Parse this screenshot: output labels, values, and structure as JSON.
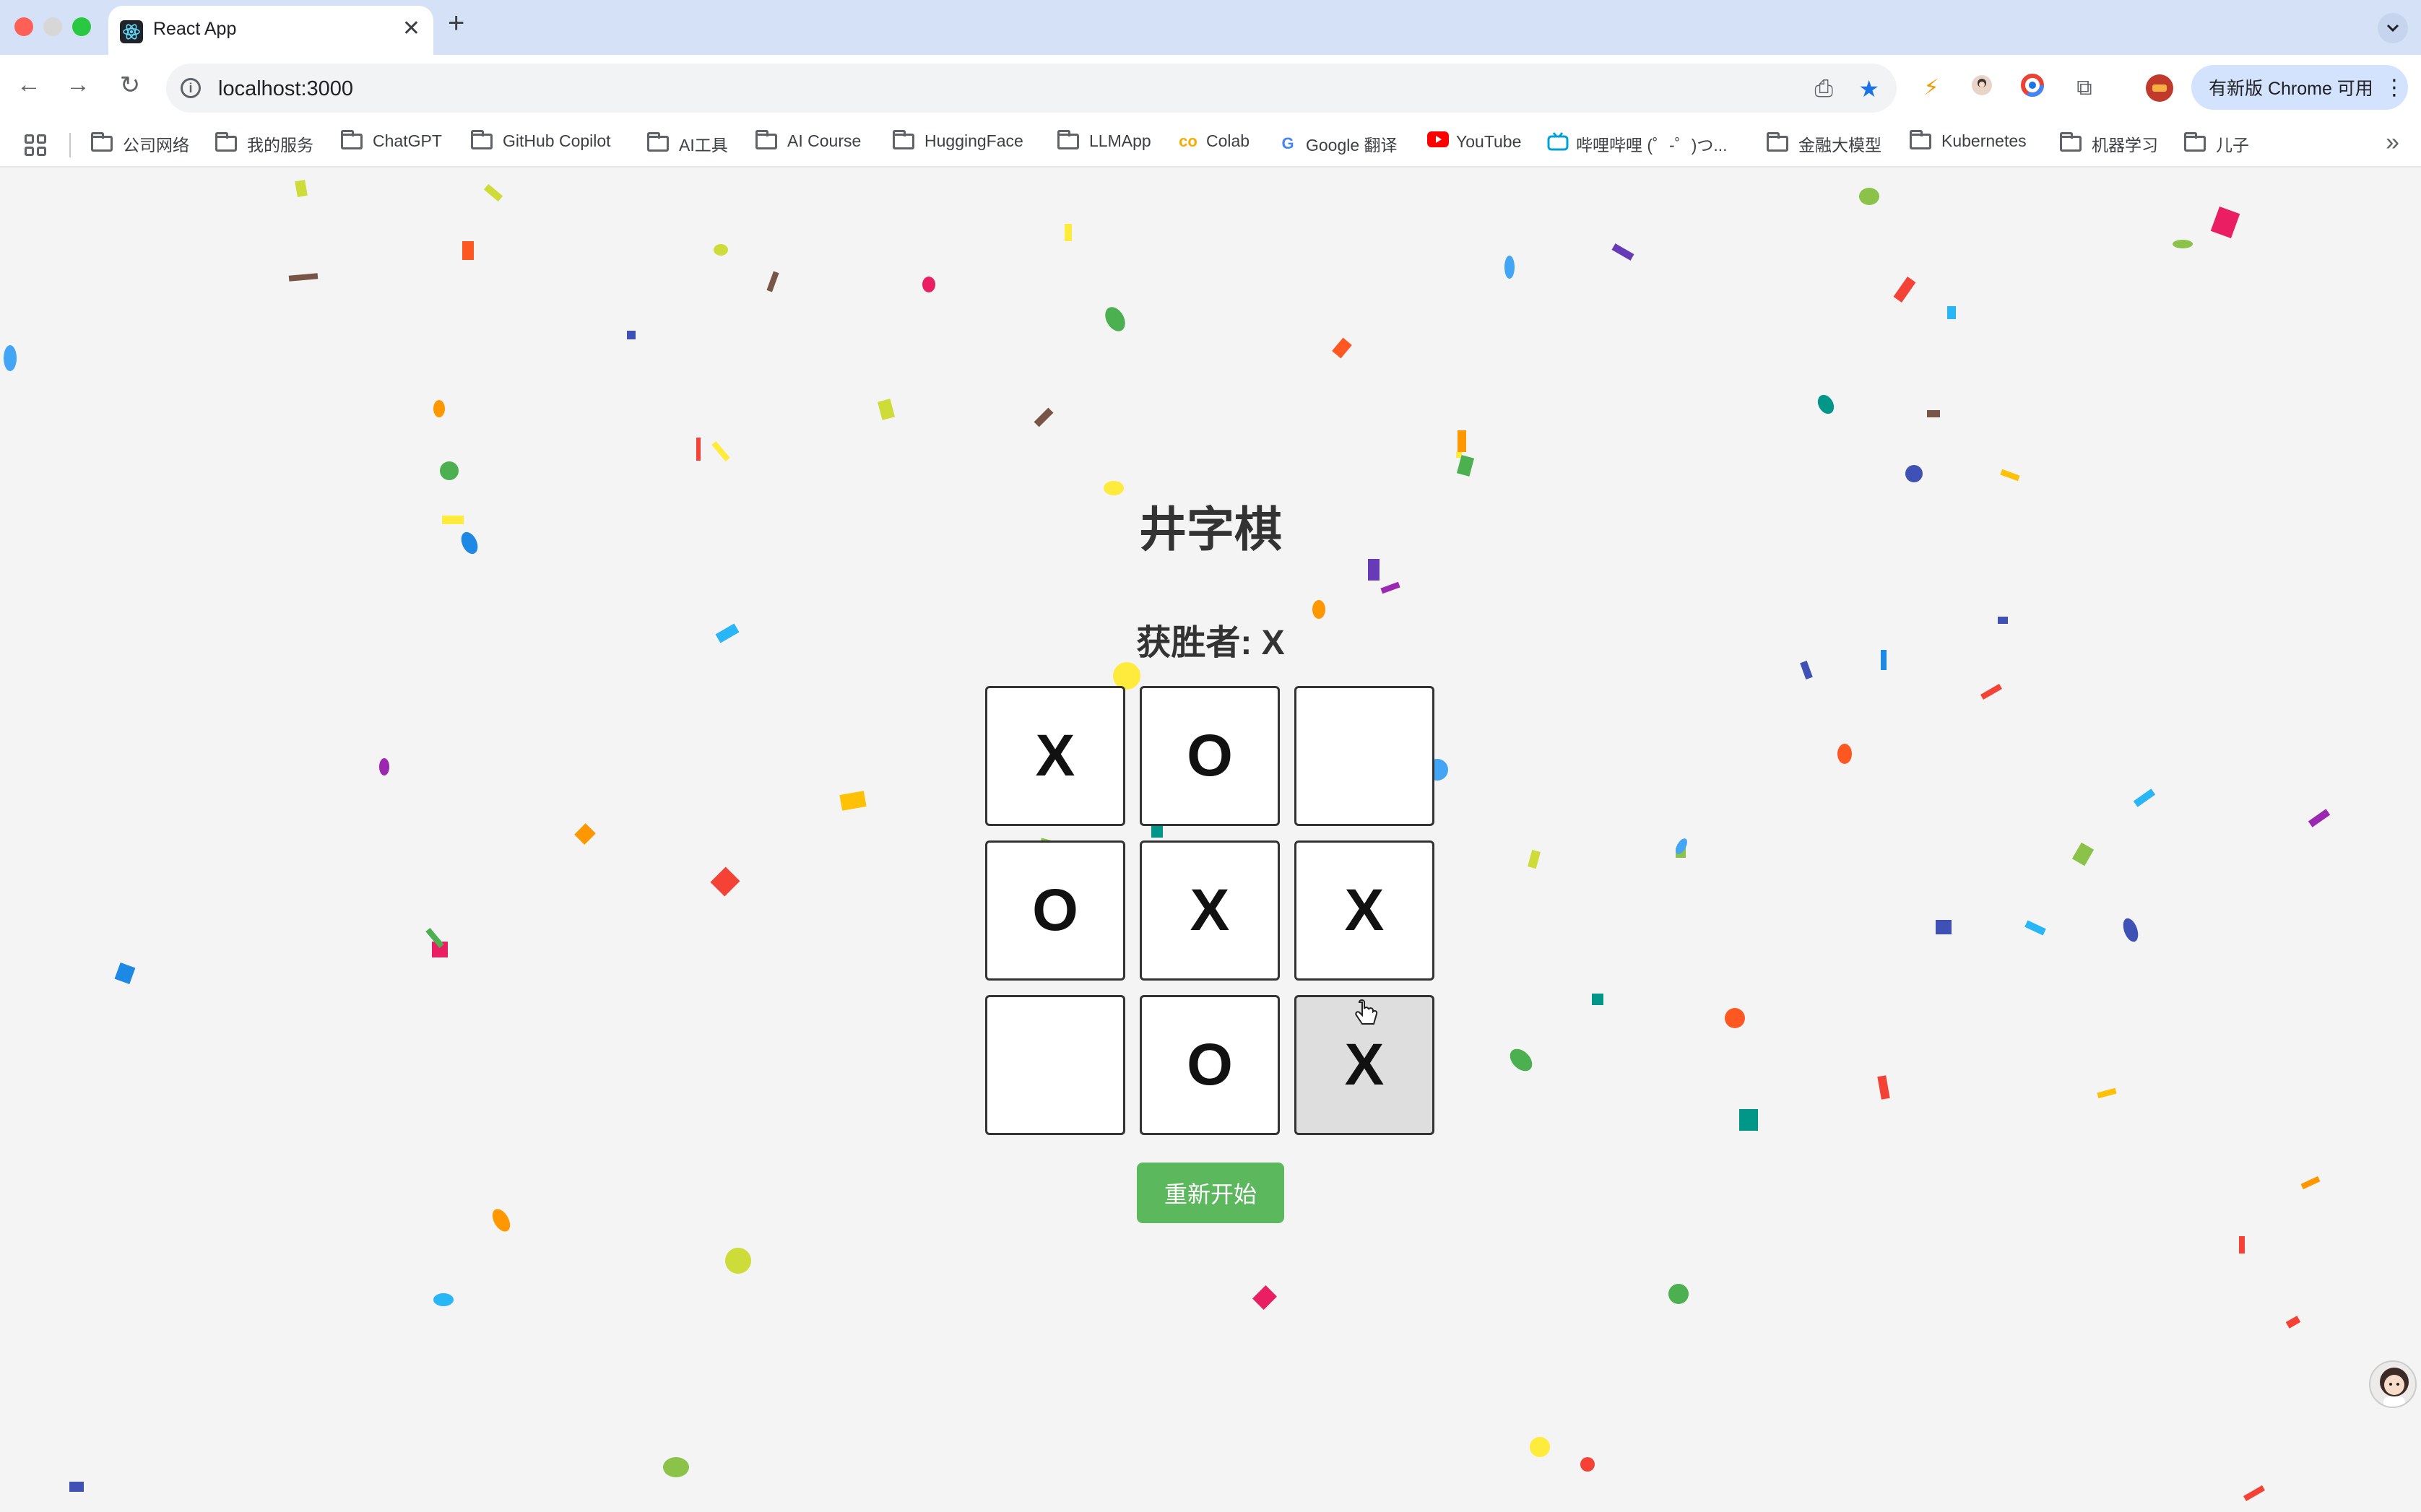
{
  "browser": {
    "tab_title": "React App",
    "url": "localhost:3000",
    "update_button": "有新版 Chrome 可用",
    "bookmarks": [
      {
        "label": "公司网络",
        "icon": "folder-icon"
      },
      {
        "label": "我的服务",
        "icon": "folder-icon"
      },
      {
        "label": "ChatGPT",
        "icon": "folder-icon"
      },
      {
        "label": "GitHub Copilot",
        "icon": "folder-icon"
      },
      {
        "label": "AI工具",
        "icon": "folder-icon"
      },
      {
        "label": "AI Course",
        "icon": "folder-icon"
      },
      {
        "label": "HuggingFace",
        "icon": "folder-icon"
      },
      {
        "label": "LLMApp",
        "icon": "folder-icon"
      },
      {
        "label": "Colab",
        "icon": "colab-icon"
      },
      {
        "label": "Google 翻译",
        "icon": "google-translate-icon"
      },
      {
        "label": "YouTube",
        "icon": "youtube-icon"
      },
      {
        "label": "哔哩哔哩 (゜-゜)つ...",
        "icon": "bilibili-icon"
      },
      {
        "label": "金融大模型",
        "icon": "folder-icon"
      },
      {
        "label": "Kubernetes",
        "icon": "folder-icon"
      },
      {
        "label": "机器学习",
        "icon": "folder-icon"
      },
      {
        "label": "儿子",
        "icon": "folder-icon"
      }
    ]
  },
  "game": {
    "title": "井字棋",
    "status": "获胜者: X",
    "board": [
      "X",
      "O",
      "",
      "O",
      "X",
      "X",
      "",
      "O",
      "X"
    ],
    "restart_label": "重新开始"
  },
  "colors": {
    "restart_button": "#5cb85c",
    "page_background": "#f4f4f4",
    "hovered_cell": "#dedede"
  }
}
